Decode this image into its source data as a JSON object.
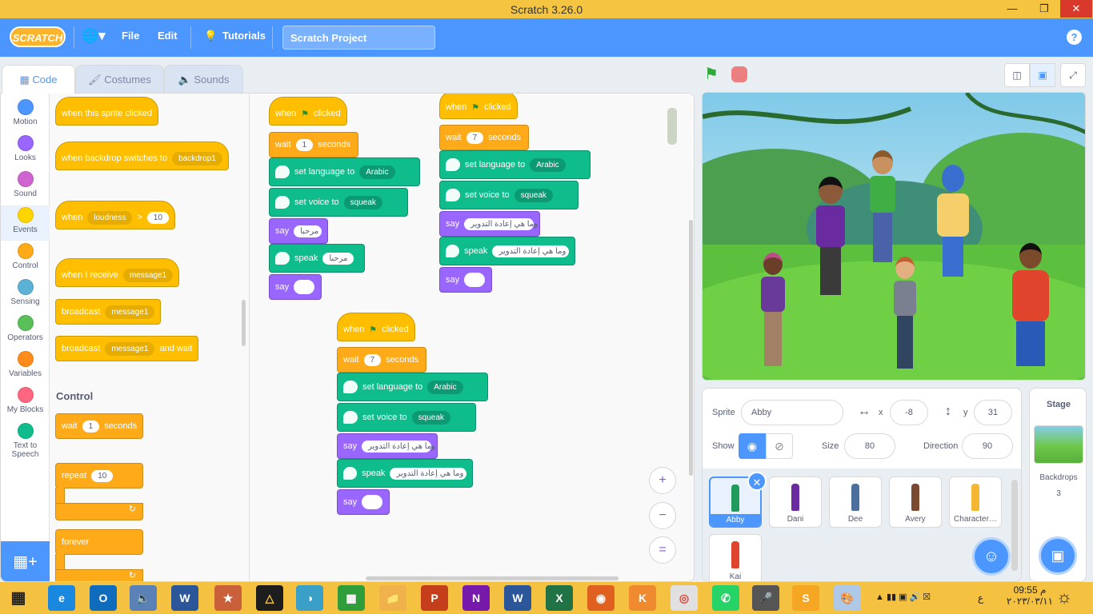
{
  "window": {
    "title": "Scratch 3.26.0"
  },
  "menubar": {
    "logo": "SCRATCH",
    "file": "File",
    "edit": "Edit",
    "tutorials": "Tutorials",
    "project_name": "Scratch Project",
    "help": "?"
  },
  "tabs": {
    "code": "Code",
    "costumes": "Costumes",
    "sounds": "Sounds"
  },
  "categories": [
    {
      "label": "Motion",
      "color": "#4c97ff"
    },
    {
      "label": "Looks",
      "color": "#9966ff"
    },
    {
      "label": "Sound",
      "color": "#cf63cf"
    },
    {
      "label": "Events",
      "color": "#ffd500"
    },
    {
      "label": "Control",
      "color": "#ffab19"
    },
    {
      "label": "Sensing",
      "color": "#5cb1d6"
    },
    {
      "label": "Operators",
      "color": "#59c059"
    },
    {
      "label": "Variables",
      "color": "#ff8c1a"
    },
    {
      "label": "My Blocks",
      "color": "#ff6680"
    },
    {
      "label": "Text to Speech",
      "color": "#0fbd8c"
    }
  ],
  "palette": {
    "when_sprite_clicked": "when this sprite clicked",
    "when_backdrop_switches": "when backdrop switches to",
    "backdrop1": "backdrop1",
    "when": "when",
    "loudness": "loudness",
    "gt": ">",
    "loudness_val": "10",
    "when_i_receive": "when I receive",
    "message1": "message1",
    "broadcast": "broadcast",
    "and_wait": "and wait",
    "control_heading": "Control",
    "wait": "wait",
    "wait_val": "1",
    "seconds": "seconds",
    "repeat": "repeat",
    "repeat_val": "10",
    "forever": "forever"
  },
  "script1": {
    "when": "when",
    "clicked": "clicked",
    "wait": "wait",
    "wait_val": "1",
    "seconds": "seconds",
    "set_language": "set language to",
    "language": "Arabic",
    "set_voice": "set voice to",
    "voice": "squeak",
    "say": "say",
    "say_text": "مرحبا",
    "speak": "speak",
    "speak_text": "مرحبا",
    "say2": "say",
    "say2_text": ""
  },
  "script2": {
    "when": "when",
    "clicked": "clicked",
    "wait": "wait",
    "wait_val": "7",
    "seconds": "seconds",
    "set_language": "set language to",
    "language": "Arabic",
    "set_voice": "set voice to",
    "voice": "squeak",
    "say": "say",
    "say_text": "وما هي إعادة التدوير",
    "speak": "speak",
    "speak_text": "وما هي إعادة التدوير",
    "say2": "say",
    "say2_text": ""
  },
  "script3": {
    "when": "when",
    "clicked": "clicked",
    "wait": "wait",
    "wait_val": "7",
    "seconds": "seconds",
    "set_language": "set language to",
    "language": "Arabic",
    "set_voice": "set voice to",
    "voice": "squeak",
    "say": "say",
    "say_text": "وما هي إعادة التدوير",
    "speak": "speak",
    "speak_text": "وما هي إعادة التدوير",
    "say2": "say",
    "say2_text": ""
  },
  "zoom": {
    "in": "+",
    "out": "−",
    "reset": "="
  },
  "sprite_info": {
    "sprite_label": "Sprite",
    "sprite_name": "Abby",
    "x_label": "x",
    "x": "-8",
    "y_label": "y",
    "y": "31",
    "show_label": "Show",
    "size_label": "Size",
    "size": "80",
    "direction_label": "Direction",
    "direction": "90"
  },
  "sprites": [
    {
      "name": "Abby",
      "color": "#1f9c5b"
    },
    {
      "name": "Dani",
      "color": "#6a2aa0"
    },
    {
      "name": "Dee",
      "color": "#4c6fa0"
    },
    {
      "name": "Avery",
      "color": "#7a4a30"
    },
    {
      "name": "Character…",
      "color": "#f5b733"
    },
    {
      "name": "Kai",
      "color": "#e0442c"
    }
  ],
  "stage_pane": {
    "title": "Stage",
    "backdrops_label": "Backdrops",
    "backdrops_count": "3"
  },
  "taskbar": {
    "time": "09:55",
    "ampm": "م",
    "date": "٢٠٢٣/٠٣/١١",
    "lang": "ع"
  }
}
